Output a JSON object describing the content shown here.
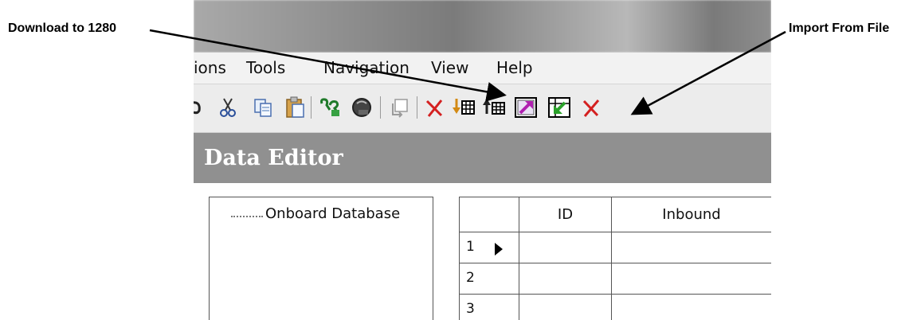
{
  "callouts": {
    "download": "Download to 1280",
    "import": "Import From File"
  },
  "menu": {
    "items": [
      "ions",
      "Tools",
      "Navigation",
      "View",
      "Help"
    ]
  },
  "toolbar": {
    "buttons": [
      "undo-icon",
      "cut-icon",
      "copy-icon",
      "paste-icon",
      "connect-icon",
      "disconnect-icon",
      "export-icon",
      "delete-icon",
      "download-icon",
      "upload-icon",
      "export-to-file-icon",
      "import-from-file-icon",
      "clear-icon"
    ]
  },
  "editor": {
    "title": "Data Editor"
  },
  "tree": {
    "root_label": "Onboard Database"
  },
  "grid": {
    "columns": [
      "",
      "ID",
      "Inbound"
    ],
    "rows": [
      {
        "num": "1"
      },
      {
        "num": "2"
      },
      {
        "num": "3"
      }
    ]
  },
  "colors": {
    "header_bg": "#909090",
    "arrow_color": "#000000",
    "delete_red": "#d42020"
  }
}
